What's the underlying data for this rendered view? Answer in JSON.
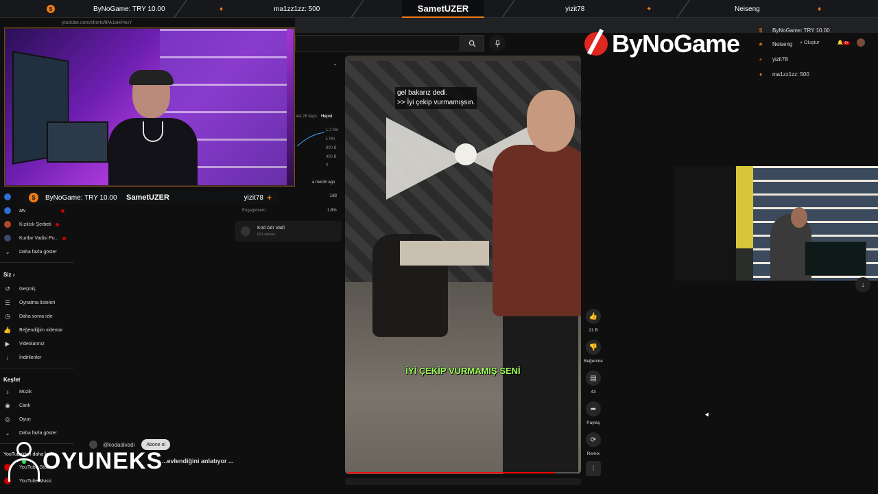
{
  "ticker": {
    "items": [
      {
        "icon": "$",
        "text": "ByNoGame: TRY 10.00"
      },
      {
        "icon": "flame",
        "text": "ma1zz1zz: 500"
      },
      {
        "icon": "",
        "text": "SametUZER"
      },
      {
        "icon": "",
        "text": "yizit78"
      },
      {
        "icon": "plus",
        "text": "Neiseng"
      }
    ],
    "center": "SametUZER"
  },
  "browser": {
    "url": "youtube.com/shorts/lPA1sHPsuY"
  },
  "logo": {
    "text": "ByNoGame"
  },
  "donations": {
    "rows": [
      {
        "icon": "$",
        "text": "ByNoGame: TRY 10.00"
      },
      {
        "icon": "★",
        "text": "Neiseng"
      },
      {
        "icon": "+",
        "text": "yizit78"
      },
      {
        "icon": "♦",
        "text": "ma1zz1zz: 500"
      }
    ],
    "create_label": "Oluştur",
    "notif_count": "9+"
  },
  "cam_bar": {
    "left": "ByNoGame: TRY 10.00",
    "title": "SametUZER",
    "right": "yizit78"
  },
  "sidebar": {
    "channels": [
      {
        "name": "atv",
        "color": "#2e6fd6"
      },
      {
        "name": "Kızılcık Şerbeti",
        "color": "#b04a2a"
      },
      {
        "name": "Kurtlar Vadisi Pu...",
        "color": "#4a4a4a"
      }
    ],
    "more_label": "Daha fazla göster",
    "you_header": "Siz",
    "you_items": [
      {
        "icon": "history-icon",
        "glyph": "↺",
        "label": "Geçmiş"
      },
      {
        "icon": "playlist-icon",
        "glyph": "☰",
        "label": "Oynatma listeleri"
      },
      {
        "icon": "clock-icon",
        "glyph": "◷",
        "label": "Daha sonra izle"
      },
      {
        "icon": "thumb-up-icon",
        "glyph": "👍",
        "label": "Beğendiğim videolar"
      },
      {
        "icon": "video-icon",
        "glyph": "▶",
        "label": "Videolarınız"
      },
      {
        "icon": "download-icon",
        "glyph": "↓",
        "label": "İndirilenler"
      }
    ],
    "explore_header": "Keşfet",
    "explore_items": [
      {
        "icon": "music-icon",
        "glyph": "♪",
        "label": "Müzik"
      },
      {
        "icon": "live-icon",
        "glyph": "◉",
        "label": "Canlı"
      },
      {
        "icon": "game-icon",
        "glyph": "◎",
        "label": "Oyun"
      },
      {
        "icon": "chevron-down-icon",
        "glyph": "⌄",
        "label": "Daha fazla göster"
      }
    ],
    "more_from_yt": "YouTube'dan daha fazla...",
    "yt_items": [
      {
        "label": "YouTube Studio"
      },
      {
        "label": "YouTube Music"
      }
    ]
  },
  "stats": {
    "last28": "Last 28 days",
    "all": "Hepsi",
    "axis": [
      "1.2 Mn",
      "1 Mn",
      "800 B",
      "400 B",
      "0"
    ],
    "ago": "a month ago",
    "count": "183",
    "engagement_label": "Engagement",
    "engagement_value": "1.8%",
    "channel_name": "Kod Adı Vadi",
    "channel_subs": "691 Abone"
  },
  "video": {
    "caption_line1": "gel bakarız dedi.",
    "caption_line2": ">> İyi çekip vurmamışsın.",
    "caption_green": "İYİ ÇEKİP VURMAMIŞ SENİ",
    "progress": 0.9
  },
  "actions": {
    "like_count": "21 B",
    "dislike_label": "Beğenme",
    "comment_count": "43",
    "share_label": "Paylaş",
    "remix_label": "Remix"
  },
  "comment": {
    "channel": "@kodadivadi",
    "subscribe": "Abone ol",
    "description": "...evlendiğini anlatıyor ..."
  },
  "watermark": {
    "text": "OYUNEKS"
  }
}
